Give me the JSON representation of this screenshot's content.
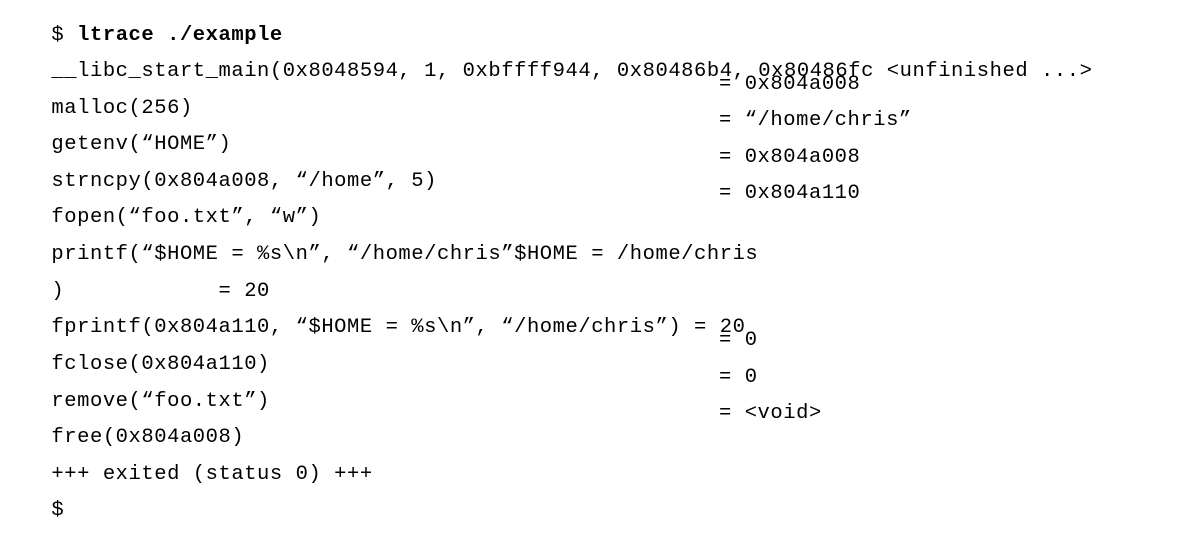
{
  "terminal": {
    "prompt": "$",
    "command": "ltrace ./example",
    "lines": [
      {
        "call": "__libc_start_main(0x8048594, 1, 0xbffff944, 0x80486b4, 0x80486fc <unfinished ...>",
        "result": ""
      },
      {
        "call": "malloc(256)",
        "result": "= 0x804a008"
      },
      {
        "call": "getenv(“HOME”)",
        "result": "= “/home/chris”"
      },
      {
        "call": "strncpy(0x804a008, “/home”, 5)",
        "result": "= 0x804a008"
      },
      {
        "call": "fopen(“foo.txt”, “w”)",
        "result": "= 0x804a110"
      },
      {
        "call": "printf(“$HOME = %s\\n”, “/home/chris”$HOME = /home/chris",
        "result": ""
      },
      {
        "call": ")            = 20",
        "result": ""
      },
      {
        "call": "fprintf(0x804a110, “$HOME = %s\\n”, “/home/chris”) = 20",
        "result": ""
      },
      {
        "call": "fclose(0x804a110)",
        "result": "= 0"
      },
      {
        "call": "remove(“foo.txt”)",
        "result": "= 0"
      },
      {
        "call": "free(0x804a008)",
        "result": "= <void>"
      },
      {
        "call": "+++ exited (status 0) +++",
        "result": ""
      }
    ],
    "final_prompt": "$"
  }
}
